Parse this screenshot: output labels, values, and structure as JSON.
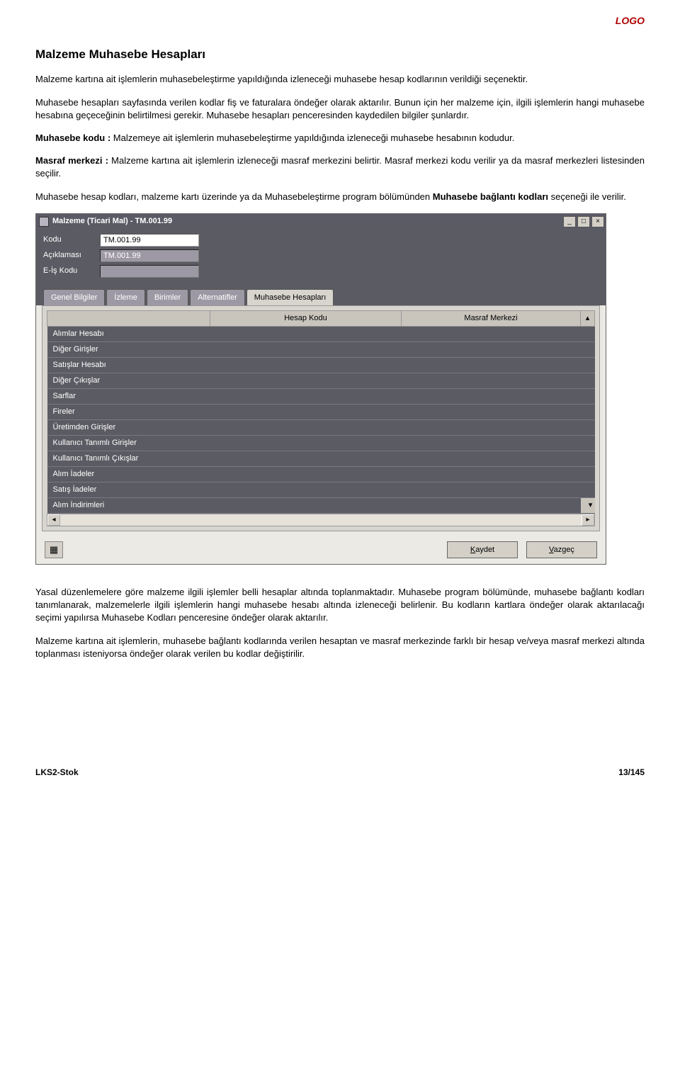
{
  "brand": "LOGO",
  "heading": "Malzeme Muhasebe Hesapları",
  "p1": "Malzeme kartına ait işlemlerin muhasebeleştirme yapıldığında izleneceği muhasebe hesap kodlarının verildiği seçenektir.",
  "p2": "Muhasebe hesapları sayfasında verilen kodlar fiş ve faturalara öndeğer olarak aktarılır. Bunun için her malzeme için, ilgili işlemlerin hangi muhasebe hesabına geçeceğinin belirtilmesi gerekir. Muhasebe hesapları penceresinden kaydedilen bilgiler şunlardır.",
  "p3_bold": "Muhasebe kodu :",
  "p3_rest": " Malzemeye ait işlemlerin muhasebeleştirme yapıldığında izleneceği muhasebe hesabının kodudur.",
  "p4_bold": "Masraf merkezi :",
  "p4_rest": " Malzeme kartına ait işlemlerin izleneceği masraf merkezini belirtir. Masraf merkezi kodu verilir ya da masraf merkezleri listesinden seçilir.",
  "p5a": "Muhasebe hesap kodları, malzeme kartı  üzerinde ya da Muhasebeleştirme program bölümünden ",
  "p5b_bold": "Muhasebe bağlantı kodları",
  "p5c": " seçeneği ile verilir.",
  "dlg": {
    "title": "Malzeme (Ticari Mal) - TM.001.99",
    "lbl_kodu": "Kodu",
    "val_kodu": "TM.001.99",
    "lbl_aciklamasi": "Açıklaması",
    "val_aciklamasi": "TM.001.99",
    "lbl_eis": "E-İş Kodu",
    "tabs": [
      "Genel Bilgiler",
      "İzleme",
      "Birimler",
      "Alternatifler",
      "Muhasebe Hesapları"
    ],
    "active_tab": 4,
    "col_blank": "",
    "col_hesap": "Hesap Kodu",
    "col_masraf": "Masraf Merkezi",
    "rows": [
      "Alımlar Hesabı",
      "Diğer Girişler",
      "Satışlar Hesabı",
      "Diğer Çıkışlar",
      "Sarflar",
      "Fireler",
      "Üretimden Girişler",
      "Kullanıcı Tanımlı Girişler",
      "Kullanıcı Tanımlı Çıkışlar",
      "Alım İadeler",
      "Satış İadeler",
      "Alım İndirimleri"
    ],
    "btn_save": "Kaydet",
    "btn_cancel": "Vazgeç"
  },
  "p6": "Yasal düzenlemelere göre malzeme ilgili işlemler belli hesaplar altında toplanmaktadır. Muhasebe program bölümünde, muhasebe bağlantı kodları tanımlanarak, malzemelerle ilgili işlemlerin hangi muhasebe hesabı altında izleneceği belirlenir. Bu kodların kartlara öndeğer olarak aktarılacağı seçimi yapılırsa Muhasebe Kodları penceresine öndeğer olarak aktarılır.",
  "p7": "Malzeme kartına ait işlemlerin, muhasebe bağlantı kodlarında verilen hesaptan ve masraf merkezinde farklı bir hesap ve/veya masraf merkezi altında toplanması isteniyorsa öndeğer olarak verilen bu kodlar değiştirilir.",
  "footer_left": "LKS2-Stok",
  "footer_right": "13/145"
}
